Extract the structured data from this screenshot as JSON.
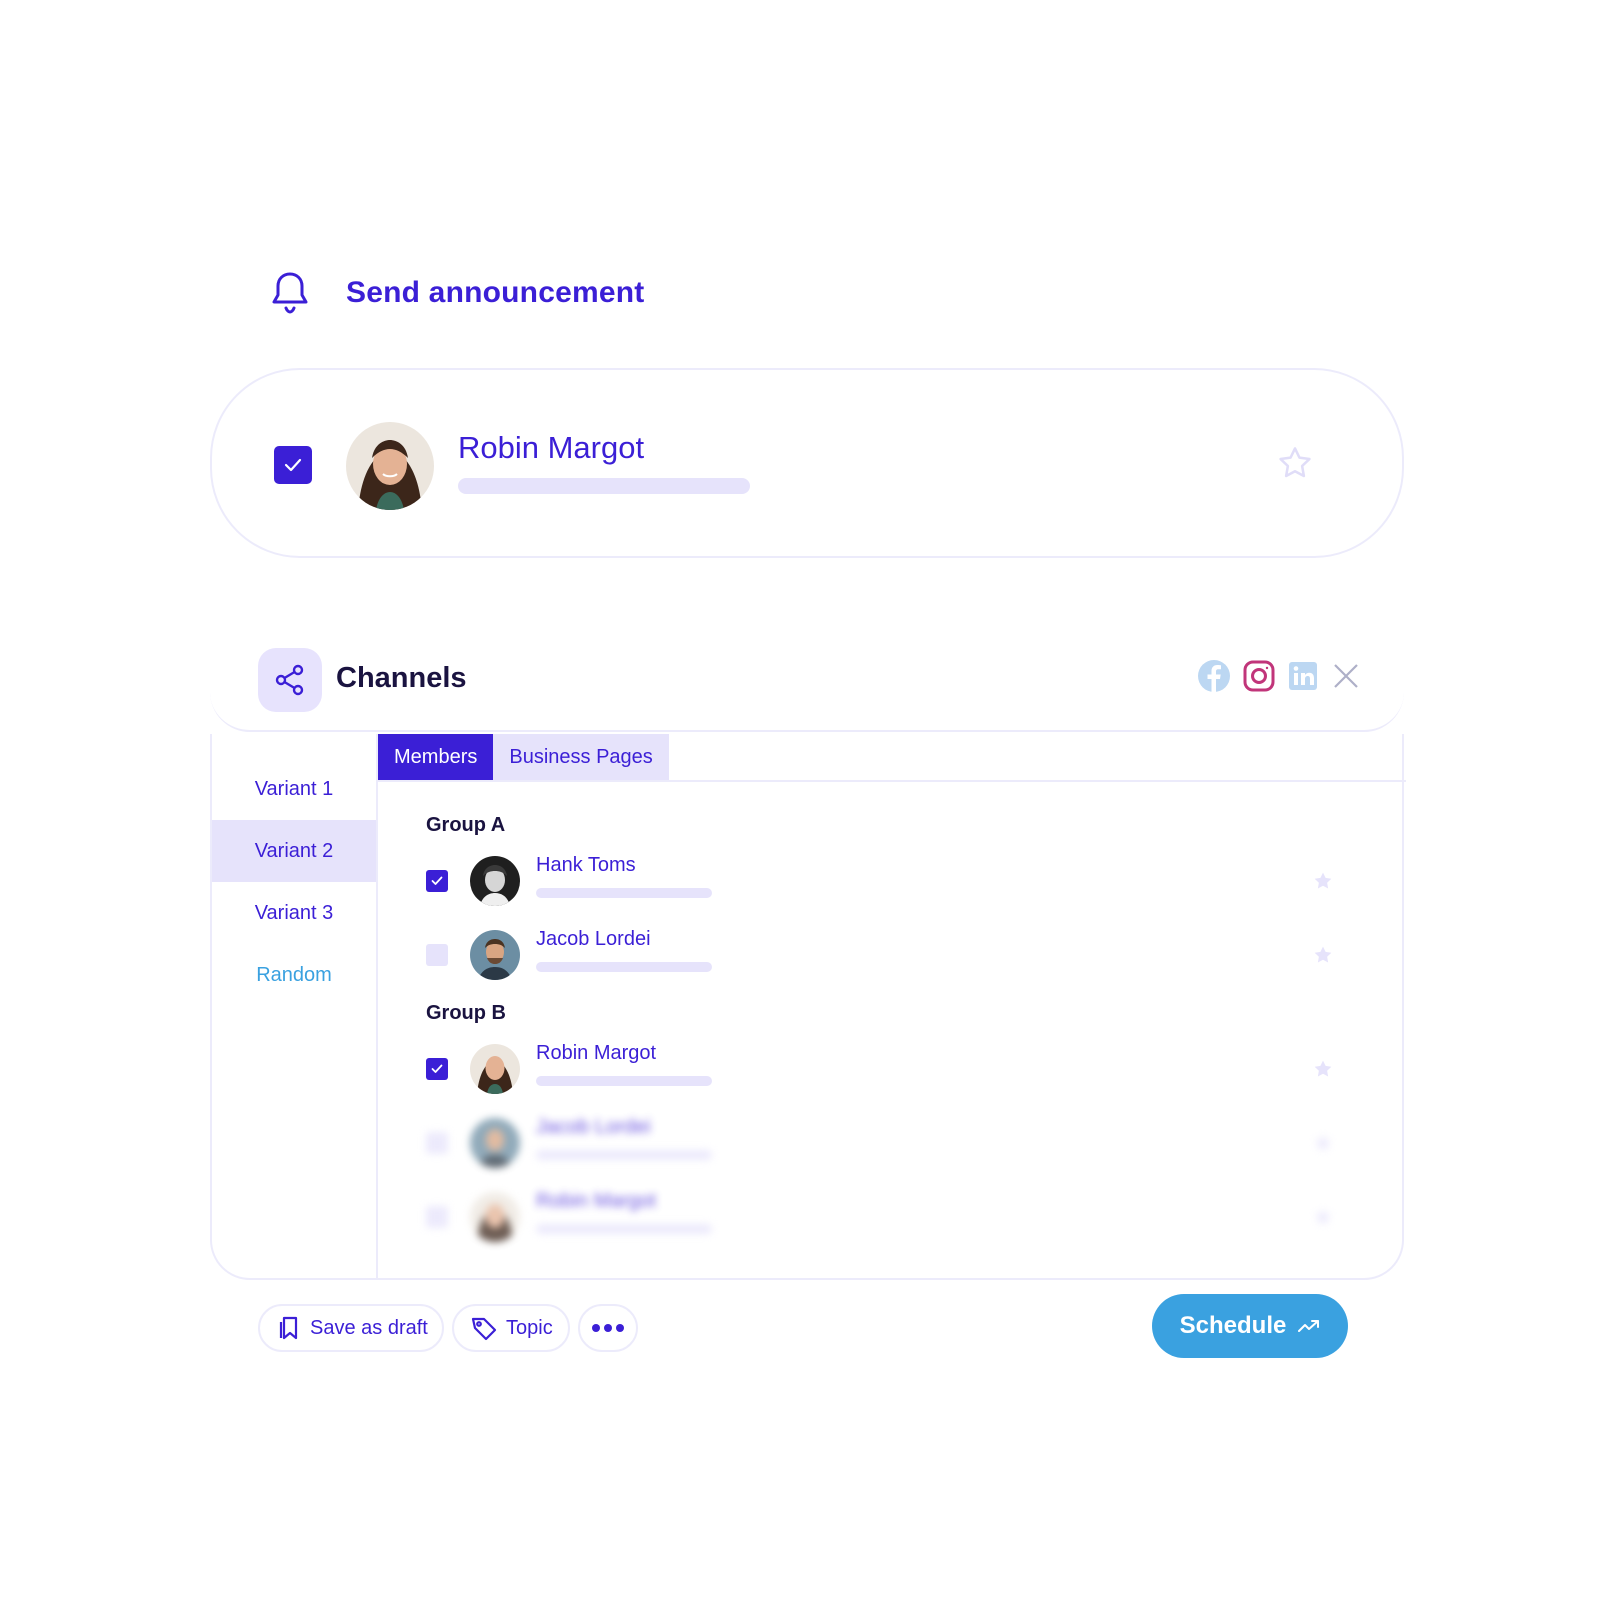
{
  "header": {
    "title": "Send announcement",
    "icon": "bell-icon"
  },
  "top_card": {
    "name": "Robin Margot",
    "checked": true,
    "favorite": false
  },
  "channels": {
    "title": "Channels",
    "social": [
      "facebook-icon",
      "instagram-icon",
      "linkedin-icon",
      "x-icon"
    ]
  },
  "variants": [
    {
      "label": "Variant 1"
    },
    {
      "label": "Variant 2"
    },
    {
      "label": "Variant 3"
    },
    {
      "label": "Random"
    }
  ],
  "tabs": [
    {
      "label": "Members"
    },
    {
      "label": "Business Pages"
    }
  ],
  "groups": [
    {
      "label": "Group A",
      "members": [
        {
          "name": "Hank Toms",
          "checked": true
        },
        {
          "name": "Jacob Lordei",
          "checked": false
        }
      ]
    },
    {
      "label": "Group B",
      "members": [
        {
          "name": "Robin Margot",
          "checked": true
        },
        {
          "name": "Jacob Lordei",
          "checked": false
        },
        {
          "name": "Robin Margot",
          "checked": false
        }
      ]
    }
  ],
  "footer": {
    "save_draft": "Save as draft",
    "topic": "Topic",
    "schedule": "Schedule"
  },
  "colors": {
    "accent": "#3b1fd6",
    "light_accent": "#e6e3fb",
    "schedule": "#3aa1e0",
    "instagram": "#c1357a"
  }
}
